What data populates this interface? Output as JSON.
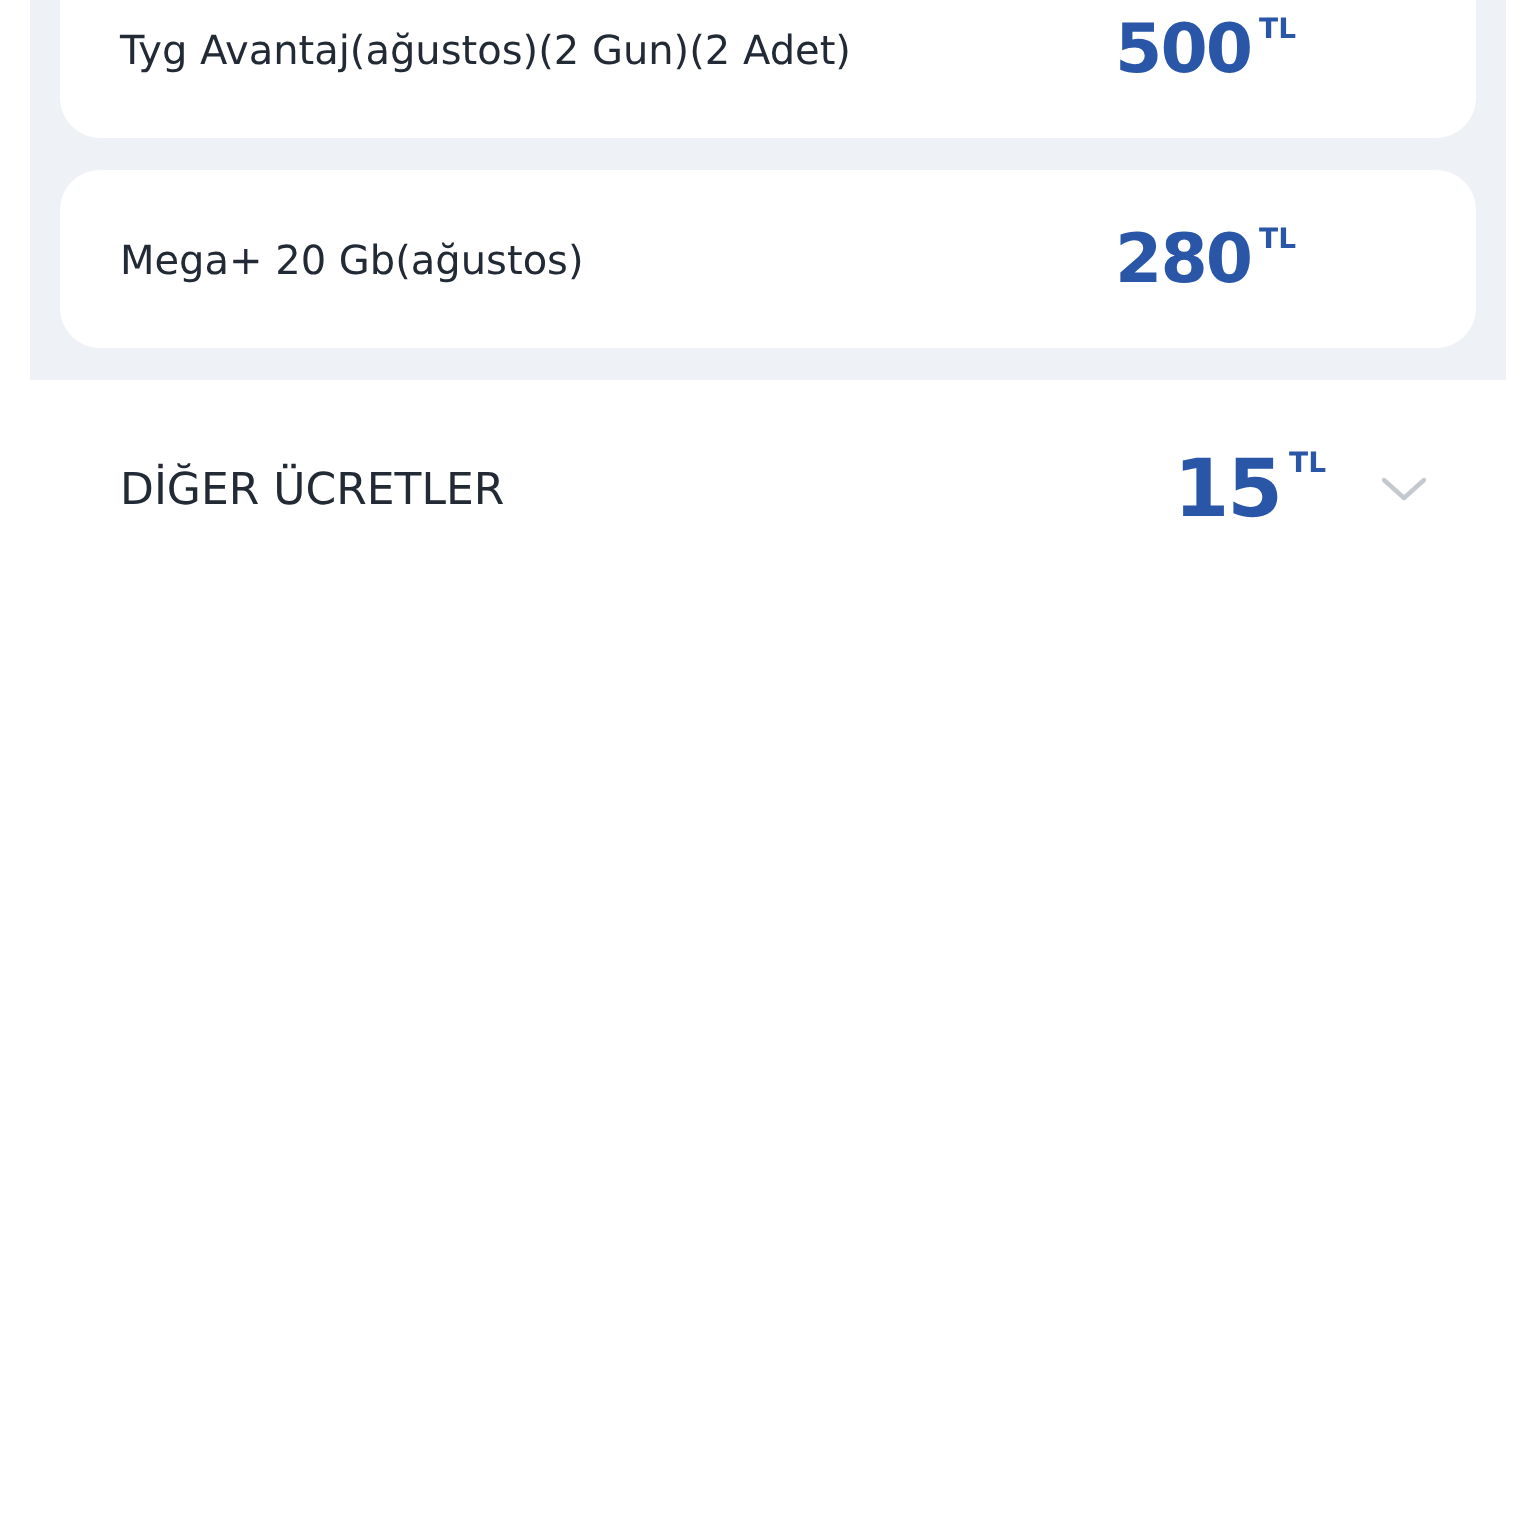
{
  "items": [
    {
      "name": "Tyg Avantaj(ağustos)(2 Gun)(2 Adet)",
      "amount": "500",
      "currency": "TL"
    },
    {
      "name": "Mega+ 20 Gb(ağustos)",
      "amount": "280",
      "currency": "TL"
    }
  ],
  "section": {
    "title": "DİĞER ÜCRETLER",
    "amount": "15",
    "currency": "TL"
  }
}
